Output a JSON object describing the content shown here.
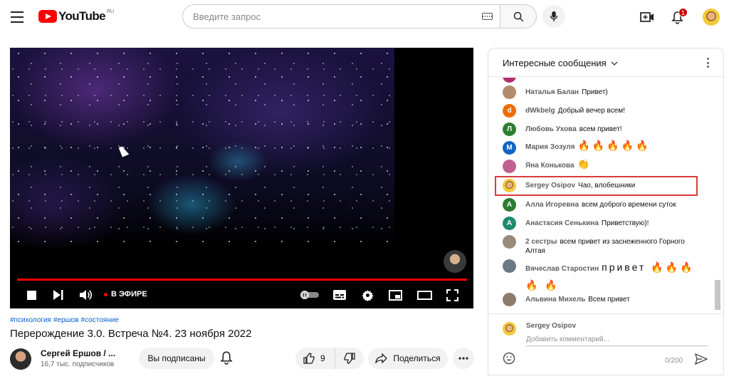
{
  "header": {
    "logo_text": "YouTube",
    "logo_region": "RU",
    "search_placeholder": "Введите запрос",
    "notification_count": "1"
  },
  "player": {
    "live_label": "В ЭФИРЕ"
  },
  "video": {
    "tags": [
      "#психология",
      "#ершов",
      "#состояние"
    ],
    "title": "Перерождение 3.0. Встреча №4. 23 ноября 2022",
    "channel_name": "Сергей Ершов / ...",
    "subscribers": "16,7 тыс. подписчиков",
    "subscribe_label": "Вы подписаны",
    "like_count": "9",
    "share_label": "Поделиться"
  },
  "chat": {
    "title": "Интересные сообщения",
    "messages": [
      {
        "author": "Наталья Балан",
        "text": "Привет)",
        "avatar_color": "#b38b6d",
        "avatar_letter": ""
      },
      {
        "author": "dWkbelg",
        "text": "Добрый вечер всем!",
        "avatar_color": "#ef6c00",
        "avatar_letter": "d"
      },
      {
        "author": "Любовь Ухова",
        "text": "всем привет!",
        "avatar_color": "#2e7d32",
        "avatar_letter": "Л"
      },
      {
        "author": "Мария Зозуля",
        "text": "🔥🔥🔥🔥🔥",
        "avatar_color": "#1565c0",
        "avatar_letter": "M"
      },
      {
        "author": "Яна Конькова",
        "text": "👏",
        "avatar_color": "#c06090",
        "avatar_letter": ""
      },
      {
        "author": "Sergey Osipov",
        "text": "Чао, влобешники",
        "avatar_color": "#f4c93a",
        "avatar_letter": ""
      },
      {
        "author": "Алла Игоревна",
        "text": "всем доброго времени суток",
        "avatar_color": "#2e7d32",
        "avatar_letter": "A"
      },
      {
        "author": "Анастасия Сенькина",
        "text": "Приветствую)!",
        "avatar_color": "#1e8a6e",
        "avatar_letter": "A"
      },
      {
        "author": "2 сестры",
        "text": "всем привет из заснеженного Горного Алтая",
        "avatar_color": "#9a8a7a",
        "avatar_letter": ""
      },
      {
        "author": "Вячеслав Старостин",
        "text": "привет 🔥🔥🔥🔥 🔥",
        "avatar_color": "#6d7a85",
        "avatar_letter": ""
      },
      {
        "author": "Альвина Михель",
        "text": "Всем привет",
        "avatar_color": "#8d7b6b",
        "avatar_letter": ""
      }
    ],
    "my_name": "Sergey Osipov",
    "input_placeholder": "Добавить комментарий...",
    "char_counter": "0/200"
  }
}
